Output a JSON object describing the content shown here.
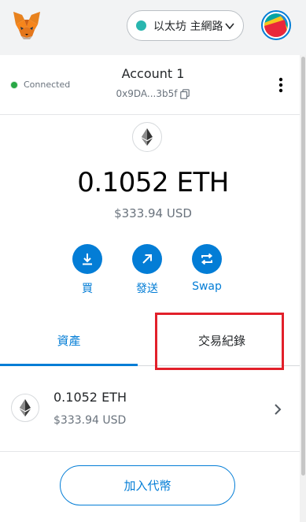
{
  "header": {
    "network_label": "以太坊 主網路",
    "network_dot_color": "#29b6af"
  },
  "account": {
    "status": "Connected",
    "name": "Account 1",
    "address_short": "0x9DA...3b5f"
  },
  "balance": {
    "amount": "0.1052 ETH",
    "fiat": "$333.94 USD"
  },
  "actions": [
    {
      "label": "買",
      "icon": "download-icon"
    },
    {
      "label": "發送",
      "icon": "arrow-up-right-icon"
    },
    {
      "label": "Swap",
      "icon": "swap-icon"
    }
  ],
  "tabs": {
    "assets": "資產",
    "activity": "交易紀錄",
    "active": "assets"
  },
  "asset_list": [
    {
      "amount": "0.1052 ETH",
      "fiat": "$333.94 USD",
      "icon": "ethereum-icon"
    }
  ],
  "add_token_label": "加入代幣",
  "colors": {
    "accent": "#037dd6",
    "highlight": "#e2202a",
    "connected": "#28a745"
  }
}
